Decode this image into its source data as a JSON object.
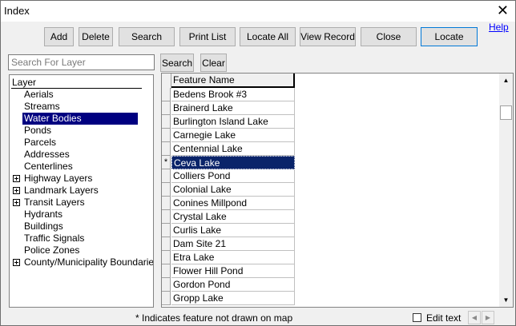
{
  "window": {
    "title": "Index",
    "close_glyph": "✕"
  },
  "toolbar": {
    "add": "Add",
    "delete": "Delete",
    "search": "Search",
    "print_list": "Print List",
    "locate_all": "Locate All",
    "view_record": "View Record",
    "close": "Close",
    "locate": "Locate",
    "help": "Help"
  },
  "search_bar": {
    "placeholder": "Search For Layer",
    "value": "",
    "search_button": "Search",
    "clear_button": "Clear"
  },
  "layers": {
    "header": "Layer",
    "items": [
      {
        "label": "Aerials",
        "expandable": false,
        "selected": false
      },
      {
        "label": "Streams",
        "expandable": false,
        "selected": false
      },
      {
        "label": "Water Bodies",
        "expandable": false,
        "selected": true
      },
      {
        "label": "Ponds",
        "expandable": false,
        "selected": false
      },
      {
        "label": "Parcels",
        "expandable": false,
        "selected": false
      },
      {
        "label": "Addresses",
        "expandable": false,
        "selected": false
      },
      {
        "label": "Centerlines",
        "expandable": false,
        "selected": false
      },
      {
        "label": "Highway Layers",
        "expandable": true,
        "selected": false
      },
      {
        "label": "Landmark Layers",
        "expandable": true,
        "selected": false
      },
      {
        "label": "Transit Layers",
        "expandable": true,
        "selected": false
      },
      {
        "label": "Hydrants",
        "expandable": false,
        "selected": false
      },
      {
        "label": "Buildings",
        "expandable": false,
        "selected": false
      },
      {
        "label": "Traffic Signals",
        "expandable": false,
        "selected": false
      },
      {
        "label": "Police Zones",
        "expandable": false,
        "selected": false
      },
      {
        "label": "County/Municipality Boundaries",
        "expandable": true,
        "selected": false
      }
    ]
  },
  "features": {
    "header": "Feature Name",
    "rows": [
      {
        "name": "Bedens Brook #3",
        "marker": "",
        "selected": false
      },
      {
        "name": "Brainerd Lake",
        "marker": "",
        "selected": false
      },
      {
        "name": "Burlington Island Lake",
        "marker": "",
        "selected": false
      },
      {
        "name": "Carnegie Lake",
        "marker": "",
        "selected": false
      },
      {
        "name": "Centennial Lake",
        "marker": "",
        "selected": false
      },
      {
        "name": "Ceva Lake",
        "marker": "*",
        "selected": true
      },
      {
        "name": "Colliers Pond",
        "marker": "",
        "selected": false
      },
      {
        "name": "Colonial Lake",
        "marker": "",
        "selected": false
      },
      {
        "name": "Conines Millpond",
        "marker": "",
        "selected": false
      },
      {
        "name": "Crystal Lake",
        "marker": "",
        "selected": false
      },
      {
        "name": "Curlis Lake",
        "marker": "",
        "selected": false
      },
      {
        "name": "Dam Site 21",
        "marker": "",
        "selected": false
      },
      {
        "name": "Etra Lake",
        "marker": "",
        "selected": false
      },
      {
        "name": "Flower Hill Pond",
        "marker": "",
        "selected": false
      },
      {
        "name": "Gordon Pond",
        "marker": "",
        "selected": false
      },
      {
        "name": "Gropp Lake",
        "marker": "",
        "selected": false
      }
    ]
  },
  "footer": {
    "note": "* Indicates feature not drawn on map",
    "edit_text_label": "Edit text",
    "edit_text_checked": false
  },
  "icons": {
    "scroll_up": "▲",
    "scroll_down": "▼",
    "scroll_left": "◀",
    "scroll_right": "▶"
  }
}
